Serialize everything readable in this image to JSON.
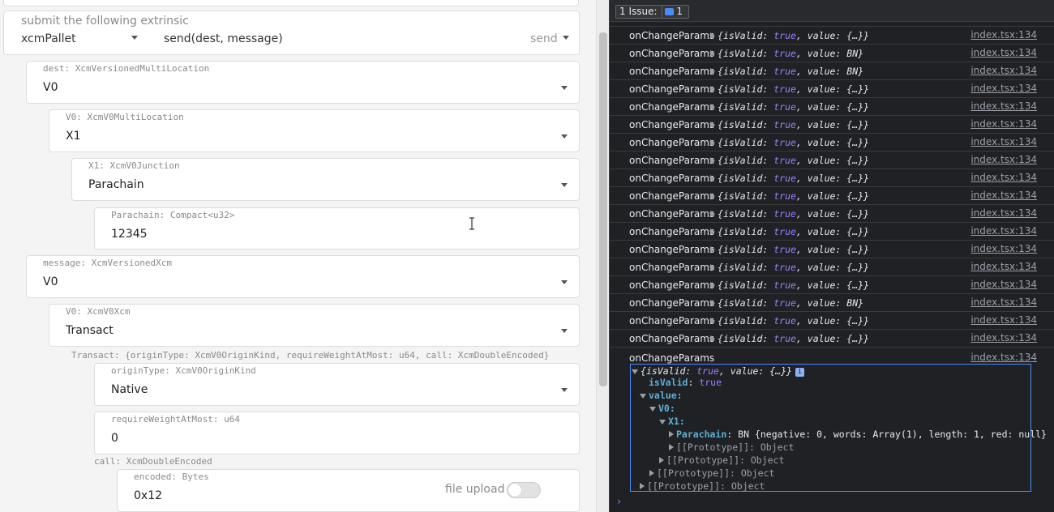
{
  "extrinsic": {
    "label": "submit the following extrinsic",
    "pallet": "xcmPallet",
    "method": "send(dest, message)",
    "send_label": "send"
  },
  "fields": {
    "dest": {
      "label": "dest: XcmVersionedMultiLocation",
      "value": "V0"
    },
    "v0_location": {
      "label": "V0: XcmV0MultiLocation",
      "value": "X1"
    },
    "x1": {
      "label": "X1: XcmV0Junction",
      "value": "Parachain"
    },
    "parachain": {
      "label": "Parachain: Compact<u32>",
      "value": "12345"
    },
    "message": {
      "label": "message: XcmVersionedXcm",
      "value": "V0"
    },
    "v0_xcm": {
      "label": "V0: XcmV0Xcm",
      "value": "Transact"
    },
    "transact_label": "Transact: {originType: XcmV0OriginKind, requireWeightAtMost: u64, call: XcmDoubleEncoded}",
    "origin_type": {
      "label": "originType: XcmV0OriginKind",
      "value": "Native"
    },
    "require_weight": {
      "label": "requireWeightAtMost: u64",
      "value": "0"
    },
    "call_label": "call: XcmDoubleEncoded",
    "encoded": {
      "label": "encoded: Bytes",
      "value": "0x12",
      "file_upload": "file upload"
    }
  },
  "devtools": {
    "issues_text": "1 Issue:",
    "issues_count": "1",
    "log_rows": [
      {
        "name": "onChangeParams",
        "value": "{…}",
        "source": "index.tsx:134"
      },
      {
        "name": "onChangeParams",
        "value": "BN",
        "source": "index.tsx:134"
      },
      {
        "name": "onChangeParams",
        "value": "BN",
        "source": "index.tsx:134"
      },
      {
        "name": "onChangeParams",
        "value": "{…}",
        "source": "index.tsx:134"
      },
      {
        "name": "onChangeParams",
        "value": "{…}",
        "source": "index.tsx:134"
      },
      {
        "name": "onChangeParams",
        "value": "{…}",
        "source": "index.tsx:134"
      },
      {
        "name": "onChangeParams",
        "value": "{…}",
        "source": "index.tsx:134"
      },
      {
        "name": "onChangeParams",
        "value": "{…}",
        "source": "index.tsx:134"
      },
      {
        "name": "onChangeParams",
        "value": "{…}",
        "source": "index.tsx:134"
      },
      {
        "name": "onChangeParams",
        "value": "{…}",
        "source": "index.tsx:134"
      },
      {
        "name": "onChangeParams",
        "value": "{…}",
        "source": "index.tsx:134"
      },
      {
        "name": "onChangeParams",
        "value": "{…}",
        "source": "index.tsx:134"
      },
      {
        "name": "onChangeParams",
        "value": "{…}",
        "source": "index.tsx:134"
      },
      {
        "name": "onChangeParams",
        "value": "{…}",
        "source": "index.tsx:134"
      },
      {
        "name": "onChangeParams",
        "value": "{…}",
        "source": "index.tsx:134"
      },
      {
        "name": "onChangeParams",
        "value": "BN",
        "source": "index.tsx:134"
      },
      {
        "name": "onChangeParams",
        "value": "{…}",
        "source": "index.tsx:134"
      },
      {
        "name": "onChangeParams",
        "value": "{…}",
        "source": "index.tsx:134"
      }
    ],
    "last_row": {
      "name": "onChangeParams",
      "source": "index.tsx:134"
    },
    "detail": {
      "summary_value": "{…}",
      "isvalid_key": "isValid",
      "isvalid_value": "true",
      "value_key": "value:",
      "v0_key": "V0:",
      "x1_key": "X1:",
      "parachain_key": "Parachain",
      "parachain_text": "BN {negative: 0, words: Array(1), length: 1, red: null}",
      "proto1": "[[Prototype]]: Object",
      "proto2": "[[Prototype]]: Object",
      "proto3": "[[Prototype]]: Object",
      "proto4": "[[Prototype]]: Object"
    }
  }
}
